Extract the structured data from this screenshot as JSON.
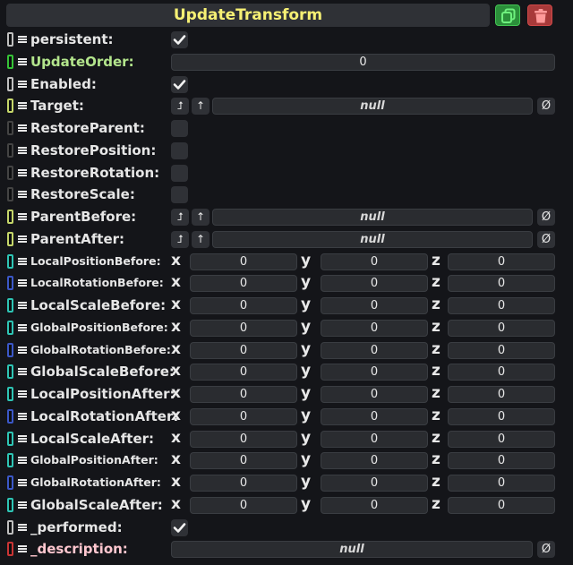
{
  "header": {
    "title": "UpdateTransform",
    "duplicate_icon": "copy-icon",
    "delete_icon": "trash-icon"
  },
  "icons": {
    "drag": "drag-handle-icon",
    "check": "checkmark-icon",
    "clear": "Ø",
    "target_jump": "⮥",
    "target_up": "↑"
  },
  "axes": {
    "x": "x",
    "y": "y",
    "z": "z"
  },
  "rows": [
    {
      "kind": "bool",
      "label": "persistent:",
      "value": true,
      "connector": "#0d0e10",
      "connector_border": "#bfbfbf"
    },
    {
      "kind": "int",
      "label": "UpdateOrder:",
      "value": "0",
      "connector": "#0d0e10",
      "connector_border": "#36c237",
      "label_color": "green"
    },
    {
      "kind": "bool",
      "label": "Enabled:",
      "value": true,
      "connector": "#0d0e10",
      "connector_border": "#bfbfbf"
    },
    {
      "kind": "ref",
      "label": "Target:",
      "value": "null",
      "connector": "#0d0e10",
      "connector_border": "#c5d66a"
    },
    {
      "kind": "bool",
      "label": "RestoreParent:",
      "value": false,
      "connector": "#0d0e10",
      "connector_border": "#444444"
    },
    {
      "kind": "bool",
      "label": "RestorePosition:",
      "value": false,
      "connector": "#0d0e10",
      "connector_border": "#444444"
    },
    {
      "kind": "bool",
      "label": "RestoreRotation:",
      "value": false,
      "connector": "#0d0e10",
      "connector_border": "#444444"
    },
    {
      "kind": "bool",
      "label": "RestoreScale:",
      "value": false,
      "connector": "#0d0e10",
      "connector_border": "#444444"
    },
    {
      "kind": "ref",
      "label": "ParentBefore:",
      "value": "null",
      "connector": "#0d0e10",
      "connector_border": "#c5d66a"
    },
    {
      "kind": "ref",
      "label": "ParentAfter:",
      "value": "null",
      "connector": "#0d0e10",
      "connector_border": "#c5d66a"
    },
    {
      "kind": "vec",
      "label": "LocalPositionBefore:",
      "small": true,
      "x": "0",
      "y": "0",
      "z": "0",
      "connector": "#0d0e10",
      "connector_border": "#2ec4b4"
    },
    {
      "kind": "vec",
      "label": "LocalRotationBefore:",
      "small": true,
      "x": "0",
      "y": "0",
      "z": "0",
      "connector": "#0d0e10",
      "connector_border": "#3b57c7"
    },
    {
      "kind": "vec",
      "label": "LocalScaleBefore:",
      "small": false,
      "x": "0",
      "y": "0",
      "z": "0",
      "connector": "#0d0e10",
      "connector_border": "#2ec4b4"
    },
    {
      "kind": "vec",
      "label": "GlobalPositionBefore:",
      "small": true,
      "x": "0",
      "y": "0",
      "z": "0",
      "connector": "#0d0e10",
      "connector_border": "#2ec4b4"
    },
    {
      "kind": "vec",
      "label": "GlobalRotationBefore:",
      "small": true,
      "x": "0",
      "y": "0",
      "z": "0",
      "connector": "#0d0e10",
      "connector_border": "#3b57c7"
    },
    {
      "kind": "vec",
      "label": "GlobalScaleBefore:",
      "small": false,
      "x": "0",
      "y": "0",
      "z": "0",
      "connector": "#0d0e10",
      "connector_border": "#2ec4b4"
    },
    {
      "kind": "vec",
      "label": "LocalPositionAfter:",
      "small": false,
      "x": "0",
      "y": "0",
      "z": "0",
      "connector": "#0d0e10",
      "connector_border": "#2ec4b4"
    },
    {
      "kind": "vec",
      "label": "LocalRotationAfter:",
      "small": false,
      "x": "0",
      "y": "0",
      "z": "0",
      "connector": "#0d0e10",
      "connector_border": "#3b57c7"
    },
    {
      "kind": "vec",
      "label": "LocalScaleAfter:",
      "small": false,
      "x": "0",
      "y": "0",
      "z": "0",
      "connector": "#0d0e10",
      "connector_border": "#2ec4b4"
    },
    {
      "kind": "vec",
      "label": "GlobalPositionAfter:",
      "small": true,
      "x": "0",
      "y": "0",
      "z": "0",
      "connector": "#0d0e10",
      "connector_border": "#2ec4b4"
    },
    {
      "kind": "vec",
      "label": "GlobalRotationAfter:",
      "small": true,
      "x": "0",
      "y": "0",
      "z": "0",
      "connector": "#0d0e10",
      "connector_border": "#3b57c7"
    },
    {
      "kind": "vec",
      "label": "GlobalScaleAfter:",
      "small": false,
      "x": "0",
      "y": "0",
      "z": "0",
      "connector": "#0d0e10",
      "connector_border": "#2ec4b4"
    },
    {
      "kind": "bool",
      "label": "_performed:",
      "value": true,
      "connector": "#0d0e10",
      "connector_border": "#bfbfbf"
    },
    {
      "kind": "string",
      "label": "_description:",
      "value": "null",
      "connector": "#0d0e10",
      "connector_border": "#c93535",
      "label_color": "red"
    }
  ]
}
